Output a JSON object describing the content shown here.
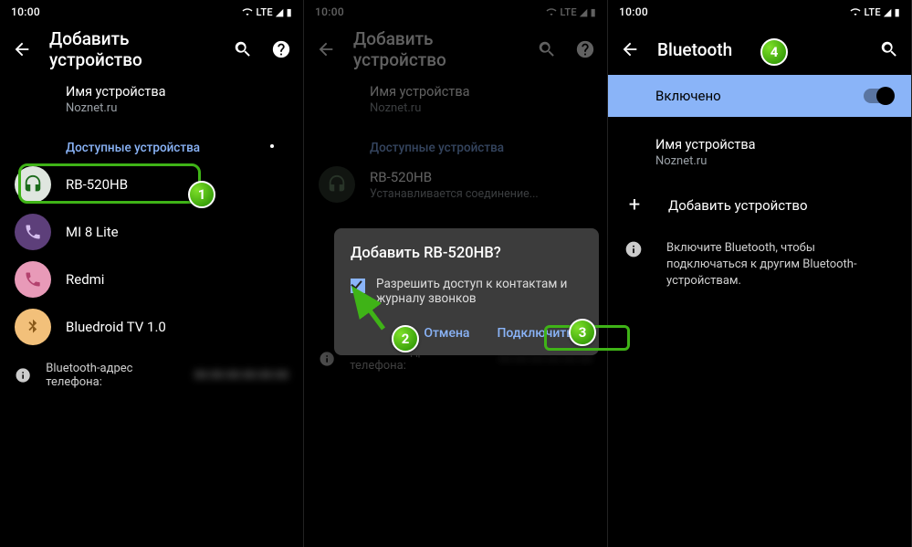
{
  "status": {
    "time": "10:00",
    "net": "LTE",
    "sig": "▲"
  },
  "pane1": {
    "title": "Добавить устройство",
    "devname_label": "Имя устройства",
    "devname": "Noznet.ru",
    "avail": "Доступные устройства",
    "items": [
      {
        "name": "RB-520HB",
        "icon": "headphone"
      },
      {
        "name": "MI 8 Lite",
        "icon": "phone-purple"
      },
      {
        "name": "Redmi",
        "icon": "phone-pink"
      },
      {
        "name": "Bluedroid TV 1.0",
        "icon": "bt"
      }
    ],
    "bt_addr_label": "Bluetooth-адрес телефона:",
    "bt_addr_value": "00:00:00:00:00:00"
  },
  "pane2": {
    "title": "Добавить устройство",
    "devname_label": "Имя устройства",
    "devname": "Noznet.ru",
    "avail": "Доступные устройства",
    "connecting_name": "RB-520HB",
    "connecting_sub": "Устанавливается соединение...",
    "bt_addr_label": "Bluetooth-адрес телефона:",
    "bt_addr_value": "00:00:00:00:00:00",
    "dialog": {
      "title": "Добавить RB-520HB?",
      "perm": "Разрешить доступ к контактам и журналу звонков",
      "cancel": "Отмена",
      "ok": "Подключить"
    }
  },
  "pane3": {
    "title": "Bluetooth",
    "enabled": "Включено",
    "devname_label": "Имя устройства",
    "devname": "Noznet.ru",
    "add": "Добавить устройство",
    "hint": "Включите Bluetooth, чтобы подключаться к другим Bluetooth-устройствам."
  },
  "badges": {
    "b1": "1",
    "b2": "2",
    "b3": "3",
    "b4": "4"
  }
}
